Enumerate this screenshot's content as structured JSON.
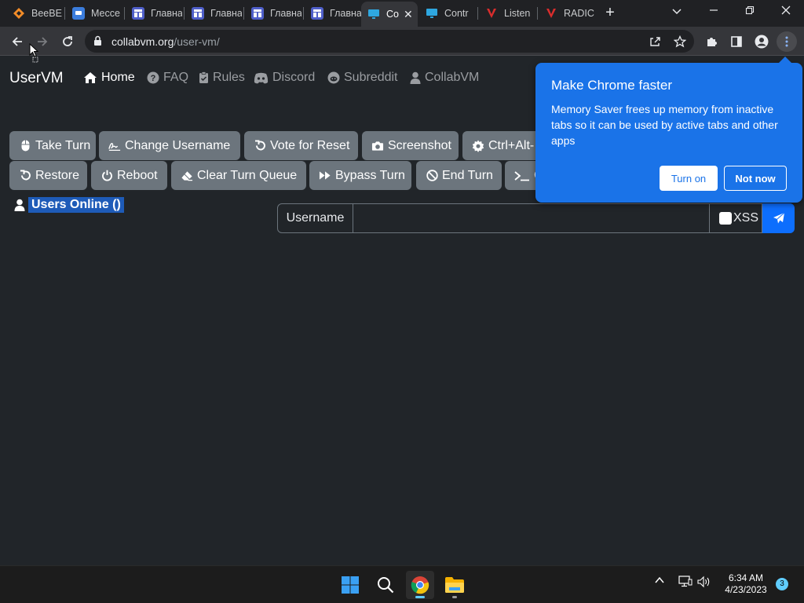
{
  "browser": {
    "tabs": [
      {
        "title": "BeeBE",
        "favicon_color": "#f28c28"
      },
      {
        "title": "Мессе",
        "favicon_color": "#3b7ddd"
      },
      {
        "title": "Главна",
        "favicon_color": "#4f5fc9"
      },
      {
        "title": "Главна",
        "favicon_color": "#4f5fc9"
      },
      {
        "title": "Главна",
        "favicon_color": "#4f5fc9"
      },
      {
        "title": "Главна",
        "favicon_color": "#4f5fc9"
      },
      {
        "title": "Co",
        "favicon_color": "#2ea7e0",
        "active": true
      },
      {
        "title": "Contr",
        "favicon_color": "#2ea7e0"
      },
      {
        "title": "Listen",
        "favicon_color": "#d92d2d"
      },
      {
        "title": "RADIC",
        "favicon_color": "#d92d2d"
      }
    ],
    "url": {
      "host": "collabvm.org",
      "path": "/user-vm/"
    }
  },
  "site": {
    "brand": "UserVM",
    "nav": [
      {
        "label": "Home",
        "icon": "home-icon",
        "active": true
      },
      {
        "label": "FAQ",
        "icon": "question-icon"
      },
      {
        "label": "Rules",
        "icon": "clipboard-icon"
      },
      {
        "label": "Discord",
        "icon": "discord-icon"
      },
      {
        "label": "Subreddit",
        "icon": "reddit-icon"
      },
      {
        "label": "CollabVM",
        "icon": "user-icon"
      }
    ],
    "controls_row1": [
      {
        "label": "Take Turn",
        "icon": "mouse-icon"
      },
      {
        "label": "Change Username",
        "icon": "signature-icon"
      },
      {
        "label": "Vote for Reset",
        "icon": "rotate-left-icon"
      },
      {
        "label": "Screenshot",
        "icon": "camera-icon"
      },
      {
        "label": "Ctrl+Alt-",
        "icon": "gear-icon"
      }
    ],
    "controls_row2": [
      {
        "label": "Restore",
        "icon": "rotate-left-icon"
      },
      {
        "label": "Reboot",
        "icon": "power-icon"
      },
      {
        "label": "Clear Turn Queue",
        "icon": "eraser-icon"
      },
      {
        "label": "Bypass Turn",
        "icon": "forward-icon"
      },
      {
        "label": "End Turn",
        "icon": "ban-icon"
      },
      {
        "label": "C",
        "icon": "terminal-icon"
      }
    ],
    "users_online_label": "Users Online ()",
    "chat": {
      "username_label": "Username",
      "input_value": "",
      "xss_label": "XSS"
    }
  },
  "popup": {
    "title": "Make Chrome faster",
    "body": "Memory Saver frees up memory from inactive tabs so it can be used by active tabs and other apps",
    "turn_on": "Turn on",
    "not_now": "Not now"
  },
  "taskbar": {
    "time": "6:34 AM",
    "date": "4/23/2023",
    "notifications": "3"
  }
}
